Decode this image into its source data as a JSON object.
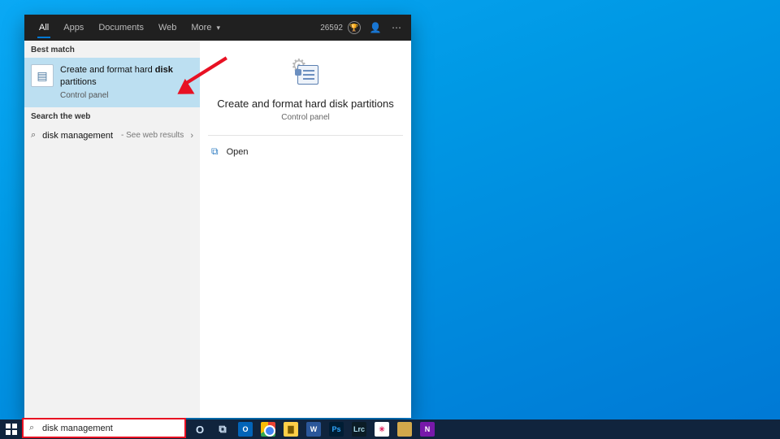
{
  "search_panel": {
    "tabs": [
      "All",
      "Apps",
      "Documents",
      "Web",
      "More"
    ],
    "active_tab": 0,
    "rewards_points": "26592",
    "sections": {
      "best_match_label": "Best match",
      "best_match": {
        "title_prefix": "Create and format hard ",
        "title_bold": "disk",
        "title_suffix": " partitions",
        "subtitle": "Control panel"
      },
      "search_web_label": "Search the web",
      "web_item": {
        "query": "disk management",
        "hint": "- See web results"
      }
    },
    "detail": {
      "title": "Create and format hard disk partitions",
      "subtitle": "Control panel",
      "actions": {
        "open": "Open"
      }
    }
  },
  "taskbar": {
    "search_value": "disk management",
    "apps": [
      {
        "id": "cortana",
        "label": "O",
        "bg": "transparent",
        "fg": "#cfe3f7"
      },
      {
        "id": "taskview",
        "label": "⧉",
        "bg": "transparent",
        "fg": "#cfe3f7"
      },
      {
        "id": "outlook",
        "label": "O",
        "bg": "#0364b8",
        "fg": "#fff"
      },
      {
        "id": "chrome",
        "label": "",
        "bg": "chrome",
        "fg": "#fff"
      },
      {
        "id": "explorer",
        "label": "▇",
        "bg": "#ffcf48",
        "fg": "#7a5a00"
      },
      {
        "id": "word",
        "label": "W",
        "bg": "#2b579a",
        "fg": "#fff"
      },
      {
        "id": "photoshop",
        "label": "Ps",
        "bg": "#001d34",
        "fg": "#31a8ff"
      },
      {
        "id": "lrc",
        "label": "Lrc",
        "bg": "#0b1c26",
        "fg": "#aedfef"
      },
      {
        "id": "slack",
        "label": "✳",
        "bg": "#ffffff",
        "fg": "#e01e5a"
      },
      {
        "id": "sticky",
        "label": "",
        "bg": "#d2a84b",
        "fg": "#fff"
      },
      {
        "id": "onenote",
        "label": "N",
        "bg": "#7719aa",
        "fg": "#fff"
      }
    ]
  },
  "colors": {
    "accent": "#0078d4",
    "highlight": "#bcdff1",
    "arrow": "#e81123"
  }
}
